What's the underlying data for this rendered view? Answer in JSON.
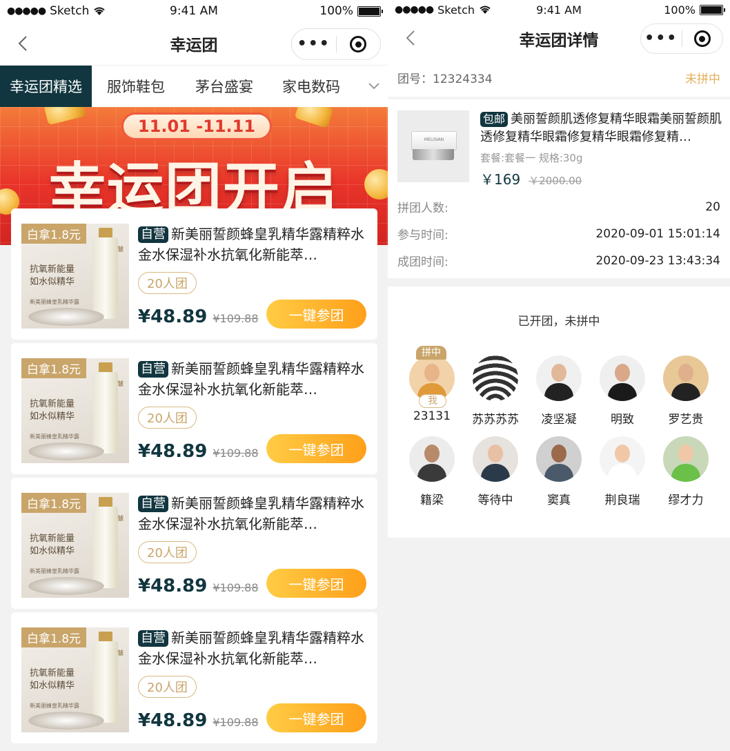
{
  "status_bar": {
    "carrier": "Sketch",
    "time": "9:41 AM",
    "battery": "100%"
  },
  "left": {
    "nav_title": "幸运团",
    "tabs": [
      {
        "label": "幸运团精选",
        "active": true
      },
      {
        "label": "服饰鞋包",
        "active": false
      },
      {
        "label": "茅台盛宴",
        "active": false
      },
      {
        "label": "家电数码",
        "active": false
      }
    ],
    "banner": {
      "date_range": "11.01 -11.11",
      "title": "幸运团开启"
    },
    "products": [
      {
        "badge": "白拿1.8元",
        "img_line1": "抗氧新能量",
        "img_line2": "如水似精华",
        "img_caption": "新美丽蜂皇乳精华露",
        "img_tag": "专业抗皱",
        "tag": "自营",
        "title": "新美丽誓颜蜂皇乳精华露精粹水金水保湿补水抗氧化新能萃…",
        "group": "20人团",
        "price": "¥48.89",
        "old_price": "¥109.88",
        "button": "一键参团"
      },
      {
        "badge": "白拿1.8元",
        "img_line1": "抗氧新能量",
        "img_line2": "如水似精华",
        "img_caption": "新美丽蜂皇乳精华露",
        "img_tag": "专业抗皱",
        "tag": "自营",
        "title": "新美丽誓颜蜂皇乳精华露精粹水金水保湿补水抗氧化新能萃…",
        "group": "20人团",
        "price": "¥48.89",
        "old_price": "¥109.88",
        "button": "一键参团"
      },
      {
        "badge": "白拿1.8元",
        "img_line1": "抗氧新能量",
        "img_line2": "如水似精华",
        "img_caption": "新美丽蜂皇乳精华露",
        "img_tag": "专业抗皱",
        "tag": "自营",
        "title": "新美丽誓颜蜂皇乳精华露精粹水金水保湿补水抗氧化新能萃…",
        "group": "20人团",
        "price": "¥48.89",
        "old_price": "¥109.88",
        "button": "一键参团"
      },
      {
        "badge": "白拿1.8元",
        "img_line1": "抗氧新能量",
        "img_line2": "如水似精华",
        "img_caption": "新美丽蜂皇乳精华露",
        "img_tag": "专业抗皱",
        "tag": "自营",
        "title": "新美丽誓颜蜂皇乳精华露精粹水金水保湿补水抗氧化新能萃…",
        "group": "20人团",
        "price": "¥48.89",
        "old_price": "¥109.88",
        "button": "一键参团"
      }
    ]
  },
  "right": {
    "nav_title": "幸运团详情",
    "group_label": "团号：",
    "group_no": "12324334",
    "group_status": "未拼中",
    "product": {
      "tag": "包邮",
      "title": "美丽誓颜肌透修复精华眼霜美丽誓颜肌透修复精华眼霜修复精华眼霜修复精…",
      "spec": "套餐:套餐一  规格:30g",
      "price": "￥169",
      "old_price": "￥2000.00",
      "jar_label": "MELISIAN"
    },
    "details": [
      {
        "label": "拼团人数:",
        "value": "20"
      },
      {
        "label": "参与时间:",
        "value": "2020-09-01 15:01:14"
      },
      {
        "label": "成团时间:",
        "value": "2020-09-23 13:43:34"
      }
    ],
    "members_status": "已开团，未拼中",
    "leader_tag": "拼中",
    "me_tag": "我",
    "members": [
      {
        "name": "23131",
        "bg": "#f2d2a8",
        "skin": "#e8b48a",
        "cloth": "#e09a3a"
      },
      {
        "name": "苏苏苏苏",
        "bg": "#ffffff",
        "skin": "#333333",
        "cloth": "#333333"
      },
      {
        "name": "凌坚凝",
        "bg": "#f0f0f0",
        "skin": "#e2b89a",
        "cloth": "#222222"
      },
      {
        "name": "明致",
        "bg": "#efefef",
        "skin": "#d8a888",
        "cloth": "#1a1a1a"
      },
      {
        "name": "罗艺贵",
        "bg": "#e8c896",
        "skin": "#e0b08c",
        "cloth": "#222222"
      },
      {
        "name": "籍梁",
        "bg": "#ececec",
        "skin": "#b88a6a",
        "cloth": "#3a3a3a"
      },
      {
        "name": "等待中",
        "bg": "#e6e2de",
        "skin": "#e8c0a4",
        "cloth": "#2a3a4a"
      },
      {
        "name": "窦真",
        "bg": "#d0d0d0",
        "skin": "#9a6a4a",
        "cloth": "#4a5a6a"
      },
      {
        "name": "荆良瑞",
        "bg": "#f4f4f4",
        "skin": "#f0c8a8",
        "cloth": "#ffffff"
      },
      {
        "name": "缪才力",
        "bg": "#c8d8b8",
        "skin": "#f0c8a8",
        "cloth": "#6ac048"
      }
    ]
  }
}
